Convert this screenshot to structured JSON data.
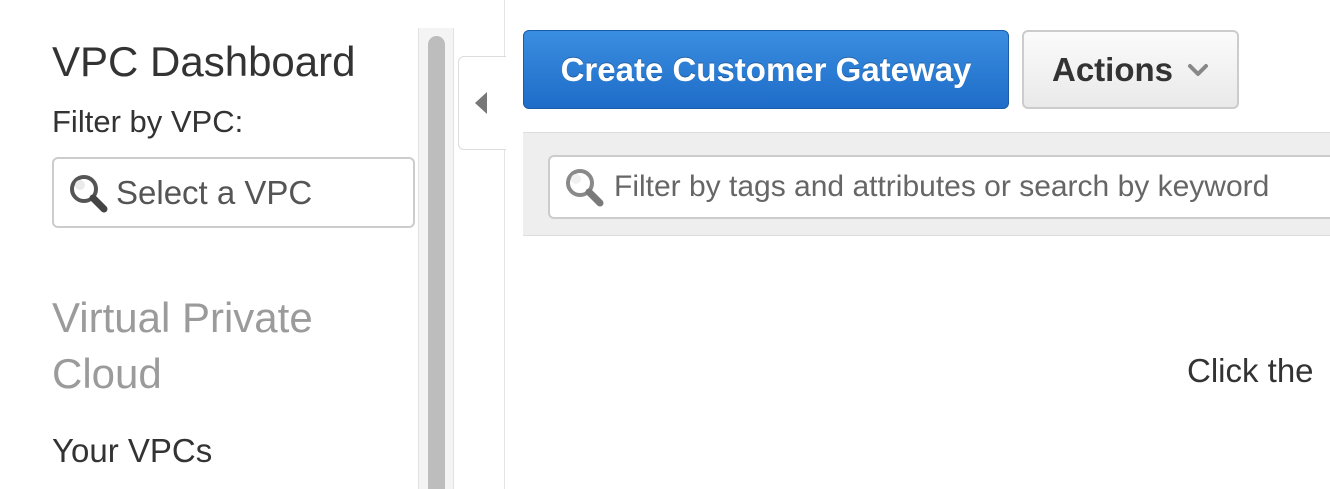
{
  "sidebar": {
    "title": "VPC Dashboard",
    "filter_label": "Filter by VPC:",
    "vpc_select": {
      "placeholder": "Select a VPC",
      "icon": "search-icon"
    },
    "section_heading": "Virtual Private Cloud",
    "items": [
      {
        "label": "Your VPCs"
      }
    ]
  },
  "collapse": {
    "icon": "chevron-left-icon"
  },
  "toolbar": {
    "create_label": "Create Customer Gateway",
    "actions_label": "Actions",
    "actions_icon": "chevron-down-icon"
  },
  "filter": {
    "placeholder": "Filter by tags and attributes or search by keyword",
    "icon": "search-icon"
  },
  "main": {
    "message": "Click the"
  },
  "colors": {
    "primary_button": "#1e6cc8",
    "section_heading": "#9b9b9b",
    "filter_bar_bg": "#eeeeee"
  }
}
